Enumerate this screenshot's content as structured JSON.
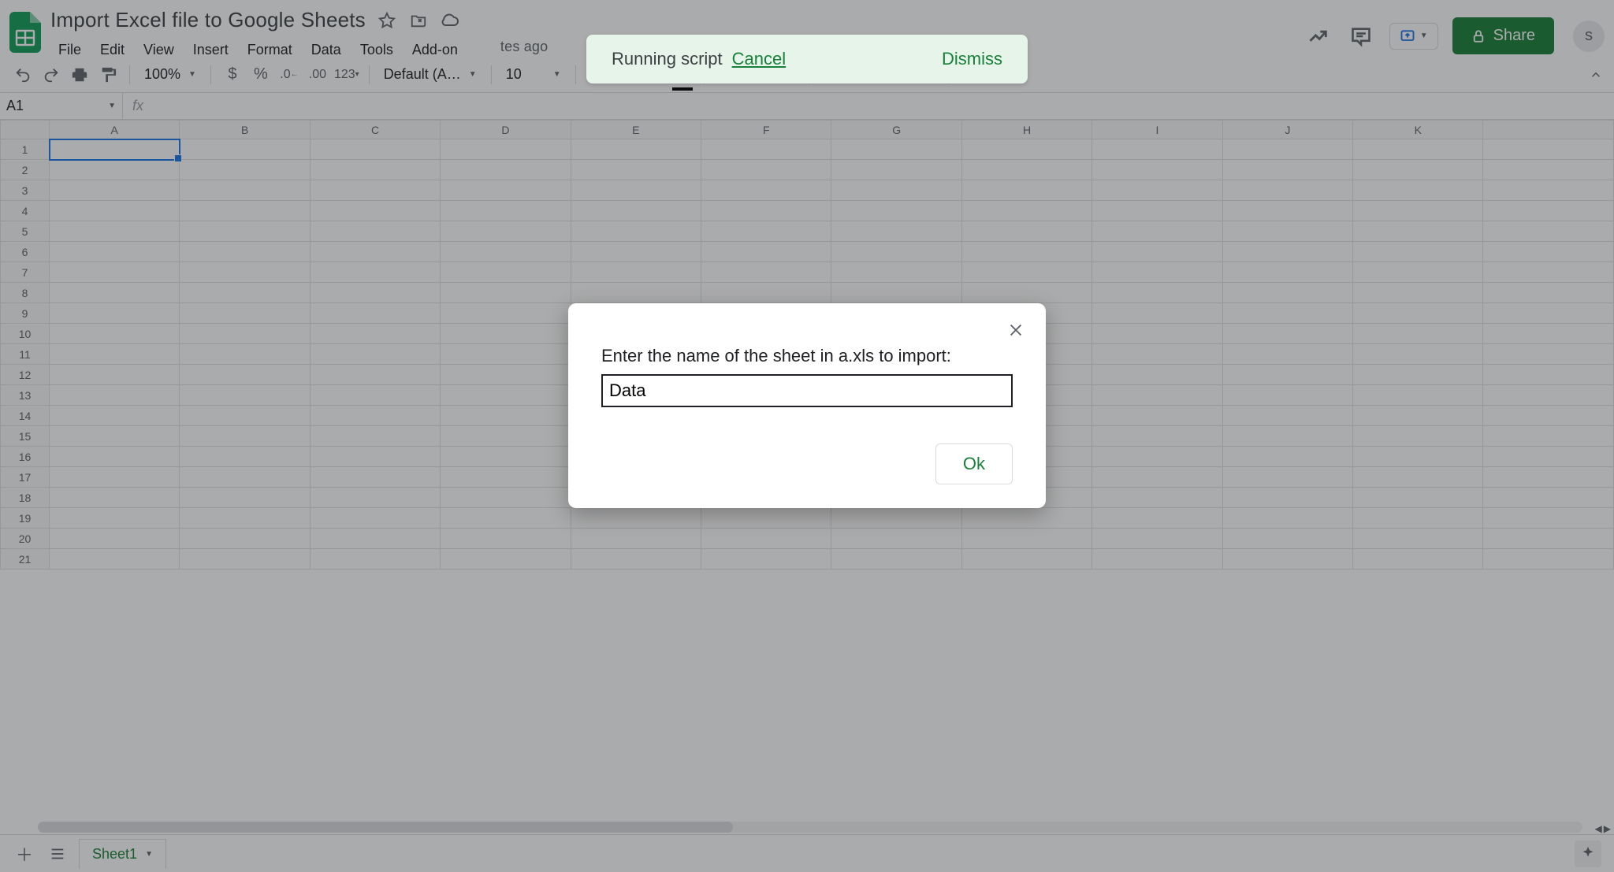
{
  "doc": {
    "title": "Import Excel file to Google Sheets"
  },
  "menu": {
    "items": [
      "File",
      "Edit",
      "View",
      "Insert",
      "Format",
      "Data",
      "Tools",
      "Add-on"
    ],
    "last_edit_fragment": "tes ago"
  },
  "toolbar": {
    "zoom": "100%",
    "font": "Default (Ari…",
    "font_size": "10"
  },
  "namebox": {
    "ref": "A1"
  },
  "columns": [
    "A",
    "B",
    "C",
    "D",
    "E",
    "F",
    "G",
    "H",
    "I",
    "J",
    "K",
    ""
  ],
  "row_count": 21,
  "tabs": {
    "sheet1": "Sheet1"
  },
  "share": {
    "label": "Share"
  },
  "avatar": {
    "initial": "s"
  },
  "toast": {
    "text": "Running script",
    "cancel": "Cancel",
    "dismiss": "Dismiss"
  },
  "dialog": {
    "label": "Enter the name of the sheet in a.xls to import:",
    "value": "Data",
    "ok": "Ok"
  }
}
